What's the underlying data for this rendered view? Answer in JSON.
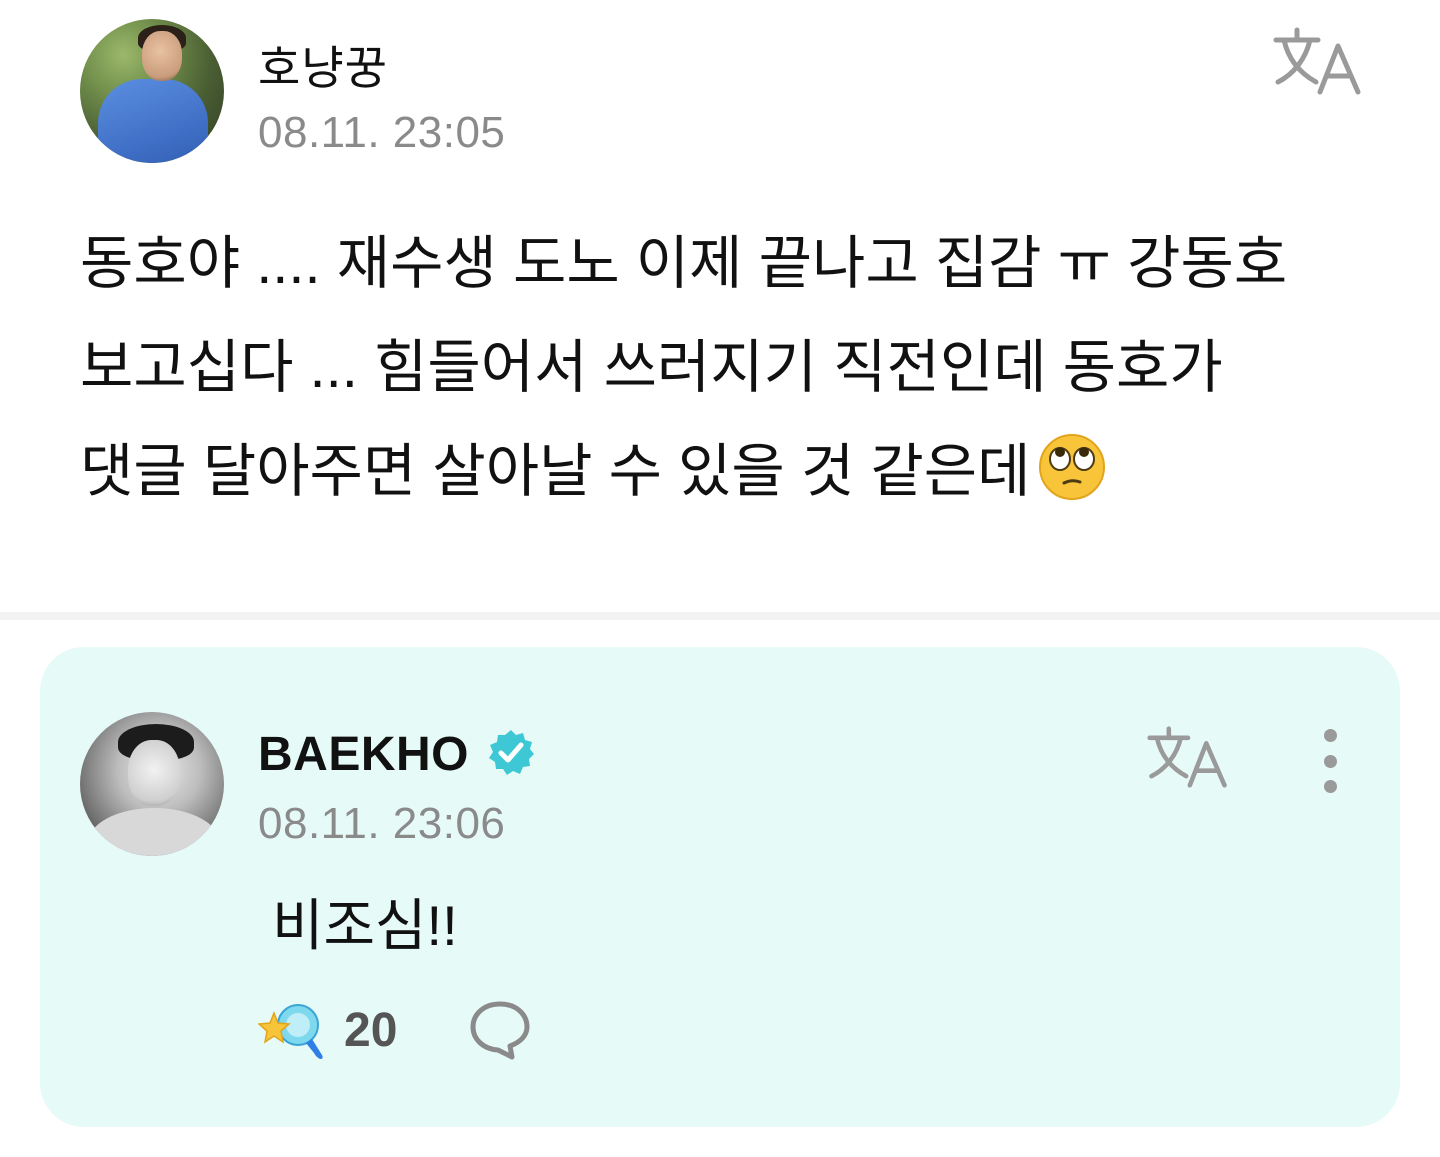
{
  "post": {
    "author": "호냥꿍",
    "timestamp": "08.11. 23:05",
    "body": "동호야 .... 재수생 도노 이제 끝나고 집감 ㅠ 강동호\n보고십다 ... 힘들어서 쓰러지기 직전인데 동호가\n댓글 달아주면 살아날 수 있을 것 같은데",
    "emoji_icon": "face-with-rolling-eyes-emoji"
  },
  "reply": {
    "author": "BAEKHO",
    "verified_icon": "verified-badge-icon",
    "timestamp": "08.11. 23:06",
    "body": "비조심!!",
    "cheer_count": "20",
    "cheer_icon": "cheer-star-icon",
    "comment_icon": "comment-bubble-icon",
    "more_icon": "more-vertical-icon"
  },
  "icons": {
    "translate": "translate-icon"
  },
  "colors": {
    "reply_card_background": "#e6fbf7",
    "verified_badge": "#3ec8d6",
    "timestamp": "#8a8a8a",
    "icon_gray": "#9a9a9a"
  }
}
